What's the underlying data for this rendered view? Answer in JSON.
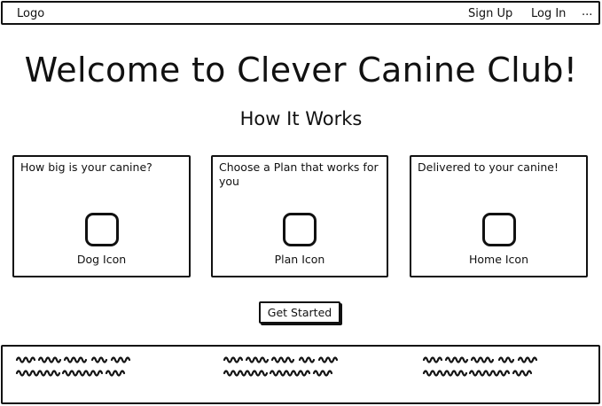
{
  "navbar": {
    "logo": "Logo",
    "links": [
      "Sign Up",
      "Log In",
      "..."
    ]
  },
  "hero": {
    "title": "Welcome to Clever Canine Club!",
    "subtitle": "How It Works"
  },
  "steps": [
    {
      "text": "How big is your canine?",
      "icon": "dog-icon-placeholder",
      "caption": "Dog Icon"
    },
    {
      "text": "Choose a Plan that works for you",
      "icon": "plan-icon-placeholder",
      "caption": "Plan Icon"
    },
    {
      "text": "Delivered to your canine!",
      "icon": "home-icon-placeholder",
      "caption": "Home Icon"
    }
  ],
  "cta": {
    "label": "Get Started"
  },
  "footer": {
    "columns": [
      "placeholder-scribble-text",
      "placeholder-scribble-text",
      "placeholder-scribble-text"
    ]
  },
  "colors": {
    "ink": "#111111",
    "background": "#ffffff"
  }
}
